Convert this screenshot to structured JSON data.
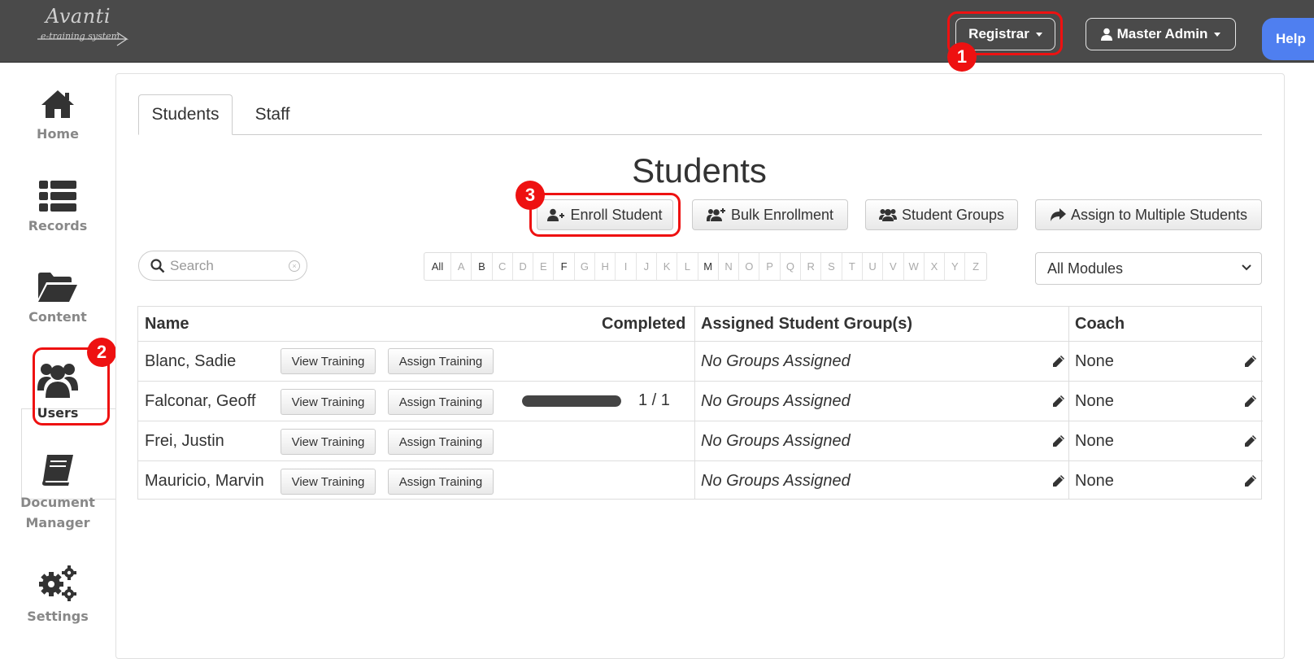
{
  "header": {
    "logo_main": "Avanti",
    "logo_sub": "e-training system",
    "registrar_label": "Registrar",
    "user_label": "Master Admin",
    "help_label": "Help",
    "badge_1": "1"
  },
  "sidebar": {
    "items": [
      {
        "label": "Home",
        "icon": "home-icon"
      },
      {
        "label": "Records",
        "icon": "list-icon"
      },
      {
        "label": "Content",
        "icon": "folder-open-icon"
      },
      {
        "label": "Users",
        "icon": "users-icon"
      },
      {
        "label": "Document\nManager",
        "icon": "book-icon"
      },
      {
        "label": "Settings",
        "icon": "gears-icon"
      }
    ],
    "badge_2": "2"
  },
  "tabs": [
    {
      "label": "Students"
    },
    {
      "label": "Staff"
    }
  ],
  "main": {
    "title": "Students",
    "badge_3": "3",
    "actions": {
      "enroll": "Enroll Student",
      "bulk": "Bulk Enrollment",
      "groups": "Student Groups",
      "assign_multi": "Assign to Multiple Students"
    },
    "search_placeholder": "Search",
    "alphabet": [
      "All",
      "A",
      "B",
      "C",
      "D",
      "E",
      "F",
      "G",
      "H",
      "I",
      "J",
      "K",
      "L",
      "M",
      "N",
      "O",
      "P",
      "Q",
      "R",
      "S",
      "T",
      "U",
      "V",
      "W",
      "X",
      "Y",
      "Z"
    ],
    "alphabet_active": [
      "All",
      "B",
      "F",
      "M"
    ],
    "modules_selected": "All Modules"
  },
  "table": {
    "headers": {
      "name": "Name",
      "completed": "Completed",
      "groups": "Assigned Student Group(s)",
      "coach": "Coach"
    },
    "view_label": "View Training",
    "assign_label": "Assign Training",
    "rows": [
      {
        "name": "Blanc, Sadie",
        "completed": "",
        "progress": null,
        "groups": "No Groups Assigned",
        "coach": "None"
      },
      {
        "name": "Falconar, Geoff",
        "completed": "1 / 1",
        "progress": 1.0,
        "groups": "No Groups Assigned",
        "coach": "None"
      },
      {
        "name": "Frei, Justin",
        "completed": "",
        "progress": null,
        "groups": "No Groups Assigned",
        "coach": "None"
      },
      {
        "name": "Mauricio, Marvin",
        "completed": "",
        "progress": null,
        "groups": "No Groups Assigned",
        "coach": "None"
      }
    ]
  },
  "colors": {
    "topbar": "#4a4a4a",
    "highlight": "#ee1111",
    "help": "#4f7ff0"
  }
}
